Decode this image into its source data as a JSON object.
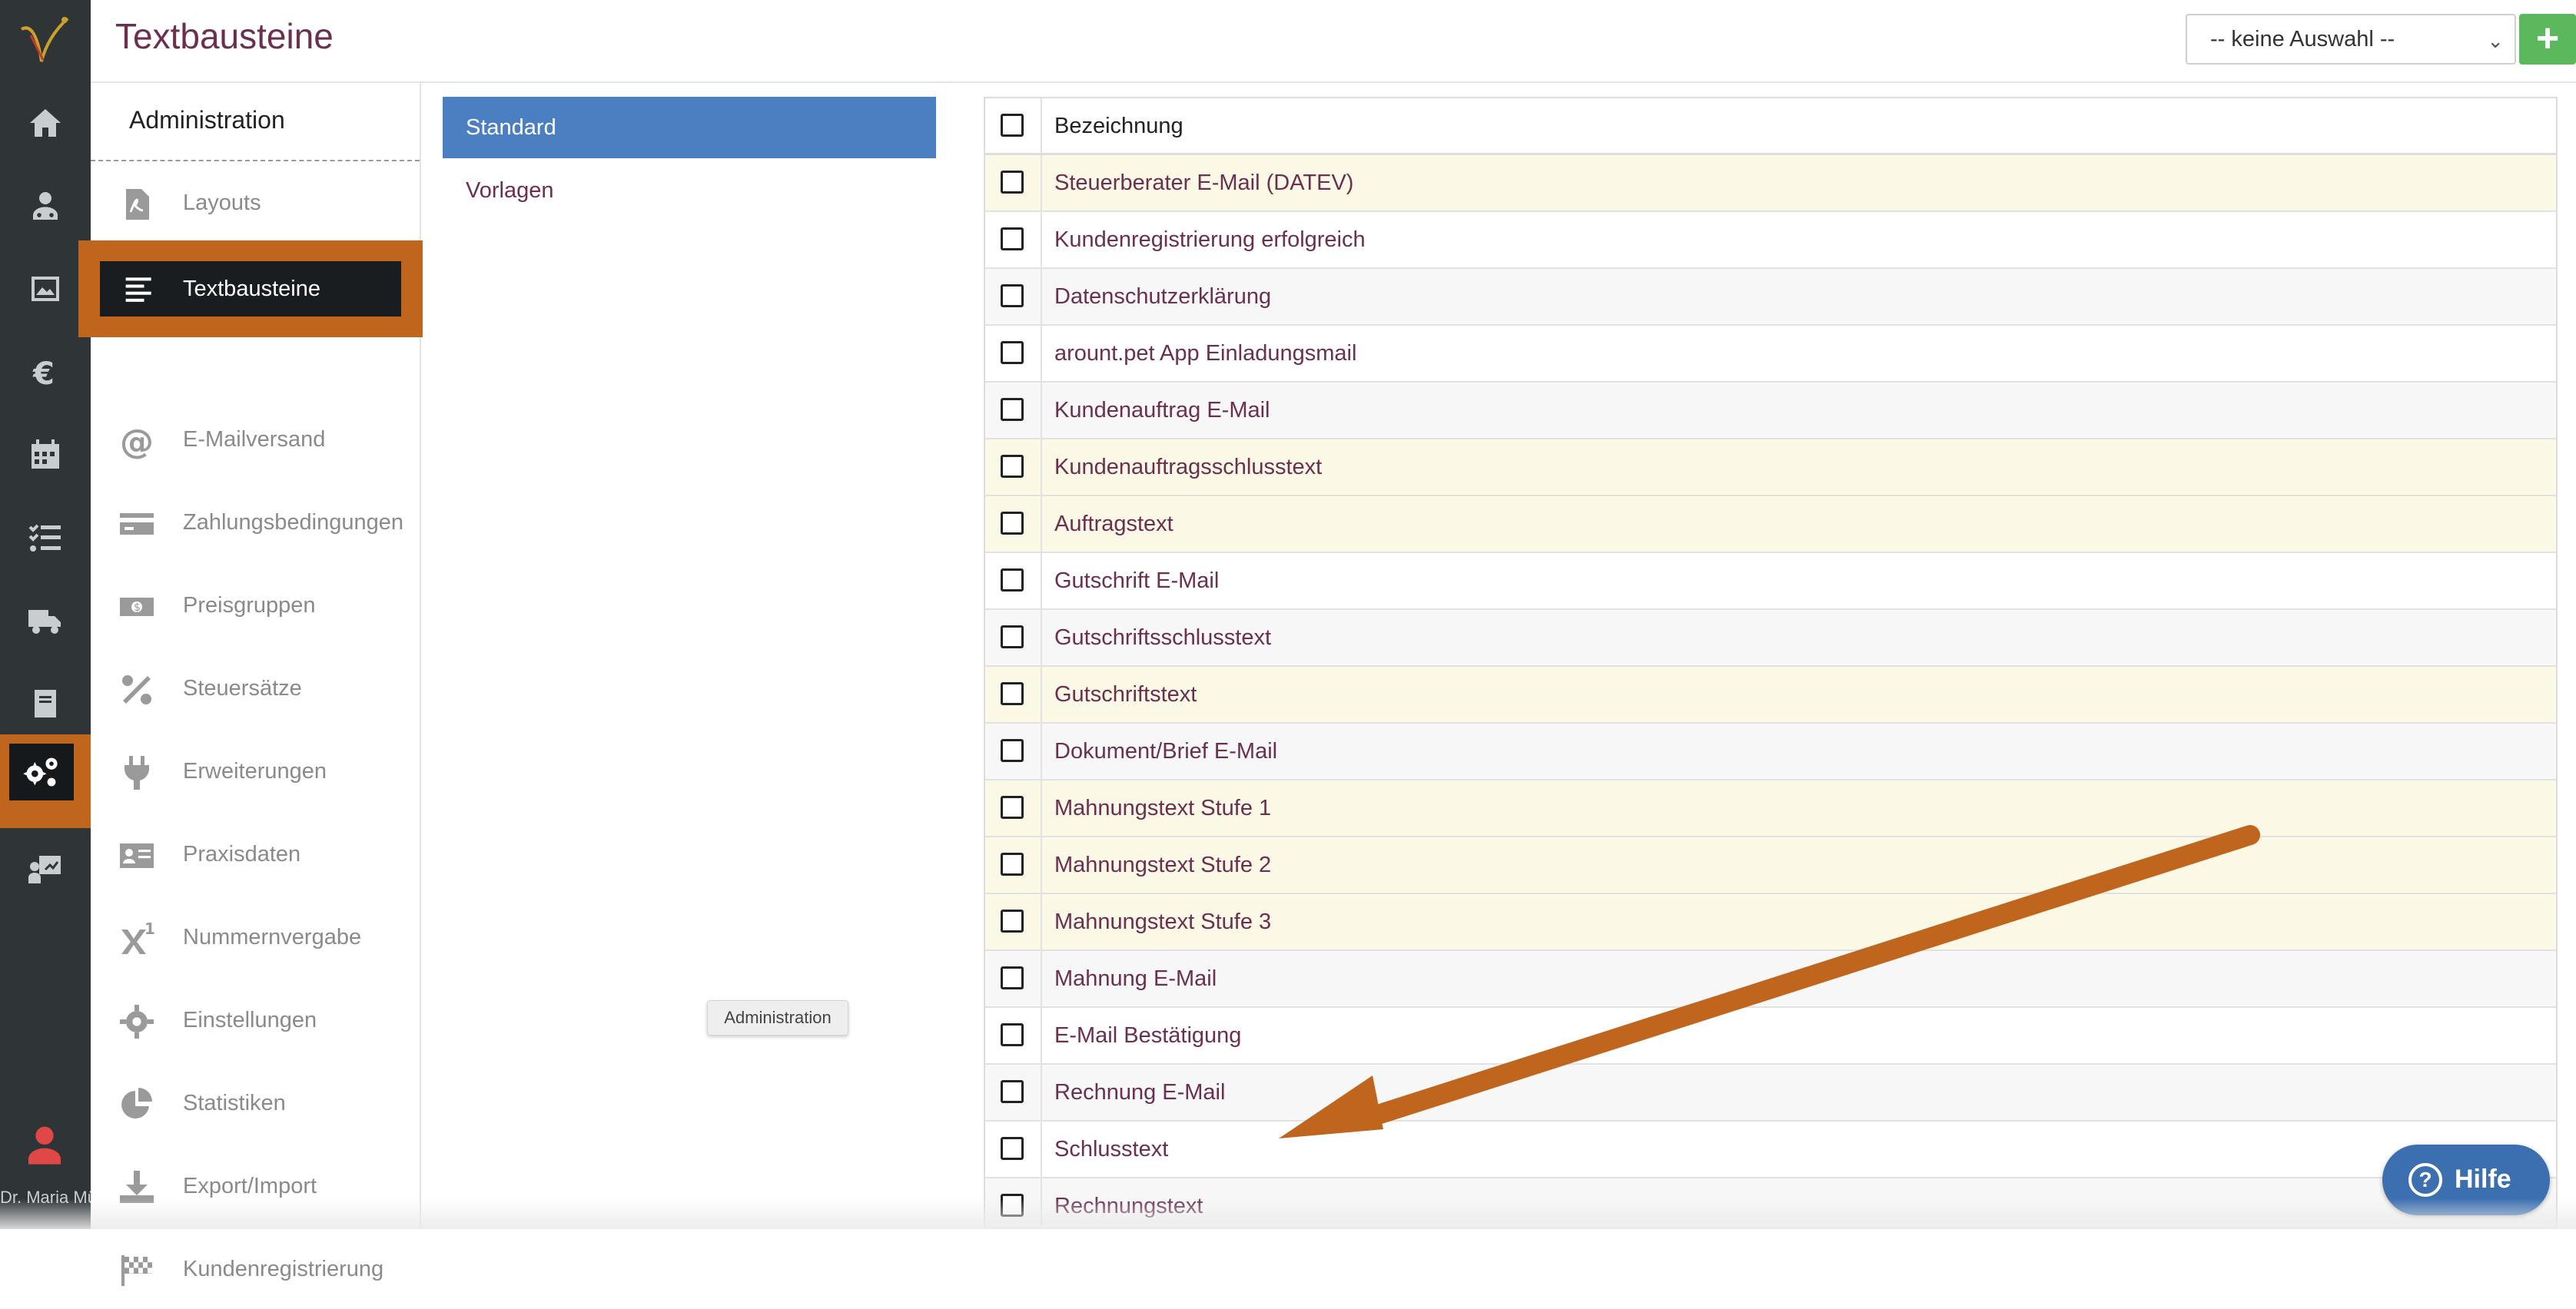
{
  "header": {
    "title": "Textbausteine",
    "select_value": "-- keine Auswahl --",
    "add_label": "+"
  },
  "rail": {
    "icons": [
      "home-icon",
      "customers-icon",
      "dashboard-icon",
      "euro-icon",
      "calendar-icon",
      "tasks-icon",
      "truck-icon",
      "book-icon",
      "settings-gears-icon",
      "presentation-icon"
    ],
    "active": "settings-gears-icon",
    "user_name": "Dr. Maria Müller"
  },
  "sidebar": {
    "title": "Administration",
    "items": [
      {
        "label": "Layouts",
        "icon": "pdf-file-icon"
      },
      {
        "label": "Textbausteine",
        "icon": "text-lines-icon",
        "active": true
      },
      {
        "label": "E-Mailversand",
        "icon": "at-sign-icon"
      },
      {
        "label": "Zahlungsbedingungen",
        "icon": "credit-card-icon"
      },
      {
        "label": "Preisgruppen",
        "icon": "money-bill-icon"
      },
      {
        "label": "Steuersätze",
        "icon": "percent-icon"
      },
      {
        "label": "Erweiterungen",
        "icon": "plug-icon"
      },
      {
        "label": "Praxisdaten",
        "icon": "id-card-icon"
      },
      {
        "label": "Nummernvergabe",
        "icon": "superscript-icon"
      },
      {
        "label": "Einstellungen",
        "icon": "gear-icon"
      },
      {
        "label": "Statistiken",
        "icon": "pie-chart-icon"
      },
      {
        "label": "Export/Import",
        "icon": "download-icon"
      },
      {
        "label": "Kundenregistrierung",
        "icon": "flag-checkered-icon"
      }
    ]
  },
  "categories": {
    "items": [
      "Standard",
      "Vorlagen"
    ],
    "active": "Standard",
    "tooltip": "Administration"
  },
  "table": {
    "header": "Bezeichnung",
    "rows": [
      "Steuerberater E-Mail (DATEV)",
      "Kundenregistrierung erfolgreich",
      "Datenschutzerklärung",
      "arount.pet App Einladungsmail",
      "Kundenauftrag E-Mail",
      "Kundenauftragsschlusstext",
      "Auftragstext",
      "Gutschrift E-Mail",
      "Gutschriftsschlusstext",
      "Gutschriftstext",
      "Dokument/Brief E-Mail",
      "Mahnungstext Stufe 1",
      "Mahnungstext Stufe 2",
      "Mahnungstext Stufe 3",
      "Mahnung E-Mail",
      "E-Mail Bestätigung",
      "Rechnung E-Mail",
      "Schlusstext",
      "Rechnungstext"
    ],
    "row_backgrounds": [
      "#fbf8e6",
      "#ffffff",
      "#f7f7f7",
      "#ffffff",
      "#f7f7f7",
      "#fbf8e6",
      "#fbf8e6",
      "#ffffff",
      "#f7f7f7",
      "#fbf8e6",
      "#f7f7f7",
      "#fbf8e6",
      "#fbf8e6",
      "#fbf8e6",
      "#f7f7f7",
      "#ffffff",
      "#f7f7f7",
      "#ffffff",
      "#f7f7f7"
    ]
  },
  "help": {
    "label": "Hilfe"
  },
  "colors": {
    "accent": "#6b2f50",
    "highlight": "#c0651e",
    "primary": "#4a7fc1",
    "success": "#5cb85c",
    "rail": "#2f3437"
  }
}
